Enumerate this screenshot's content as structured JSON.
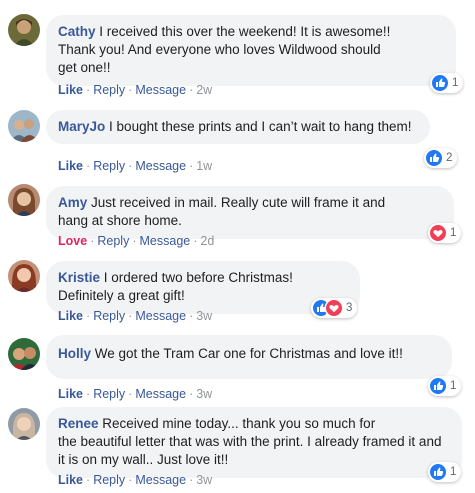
{
  "comments": [
    {
      "author": "Cathy",
      "text": "I received this over the weekend! It is awesome!!\nThank you! And everyone who loves Wildwood should\nget one!!",
      "reaction_label": "Like",
      "reply": "Reply",
      "message": "Message",
      "time": "2w",
      "reaction_count": "1",
      "reactions": [
        "like"
      ]
    },
    {
      "author": "MaryJo",
      "text": "I bought these prints and I can’t wait to hang them!",
      "reaction_label": "Like",
      "reply": "Reply",
      "message": "Message",
      "time": "1w",
      "reaction_count": "2",
      "reactions": [
        "like"
      ]
    },
    {
      "author": "Amy",
      "text": "Just received in mail. Really cute will frame it and\nhang at shore home.",
      "reaction_label": "Love",
      "reply": "Reply",
      "message": "Message",
      "time": "2d",
      "reaction_count": "1",
      "reactions": [
        "love"
      ]
    },
    {
      "author": "Kristie",
      "text": "I ordered two before Christmas!\nDefinitely a great gift!",
      "reaction_label": "Like",
      "reply": "Reply",
      "message": "Message",
      "time": "3w",
      "reaction_count": "3",
      "reactions": [
        "like",
        "love"
      ]
    },
    {
      "author": "Holly",
      "text": "We got the Tram Car one for Christmas and love it!!",
      "reaction_label": "Like",
      "reply": "Reply",
      "message": "Message",
      "time": "3w",
      "reaction_count": "1",
      "reactions": [
        "like"
      ]
    },
    {
      "author": "Renee",
      "text": "Received mine today... thank you so much for\nthe beautiful letter that was with the print. I already framed it and\nit is on my wall.. Just love it!!",
      "reaction_label": "Like",
      "reply": "Reply",
      "message": "Message",
      "time": "3w",
      "reaction_count": "1",
      "reactions": [
        "like"
      ]
    }
  ],
  "colors": {
    "author": "#385898",
    "bubble": "#f2f3f5",
    "like_icon": "#2078f4",
    "love_icon": "#f33e58",
    "love_text": "#e0245e",
    "timestamp": "#90949c"
  },
  "icons": {
    "like": "thumbs-up-icon",
    "love": "heart-icon"
  }
}
